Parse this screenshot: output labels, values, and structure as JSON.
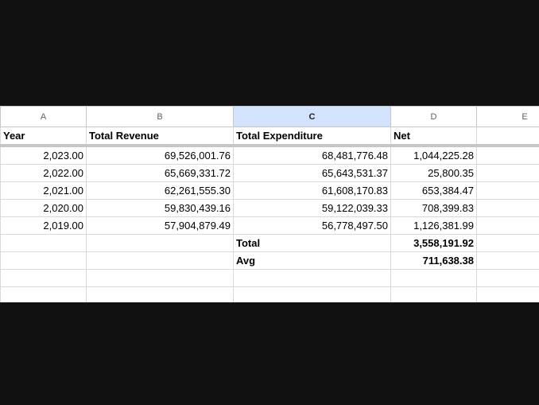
{
  "columns": [
    "A",
    "B",
    "C",
    "D",
    "E"
  ],
  "header": {
    "year": "Year",
    "revenue": "Total Revenue",
    "expenditure": "Total Expenditure",
    "net": "Net"
  },
  "rows": [
    {
      "year": "2,023.00",
      "revenue": "69,526,001.76",
      "expenditure": "68,481,776.48",
      "net": "1,044,225.28"
    },
    {
      "year": "2,022.00",
      "revenue": "65,669,331.72",
      "expenditure": "65,643,531.37",
      "net": "25,800.35"
    },
    {
      "year": "2,021.00",
      "revenue": "62,261,555.30",
      "expenditure": "61,608,170.83",
      "net": "653,384.47"
    },
    {
      "year": "2,020.00",
      "revenue": "59,830,439.16",
      "expenditure": "59,122,039.33",
      "net": "708,399.83"
    },
    {
      "year": "2,019.00",
      "revenue": "57,904,879.49",
      "expenditure": "56,778,497.50",
      "net": "1,126,381.99"
    }
  ],
  "summary": {
    "total_label": "Total",
    "total_value": "3,558,191.92",
    "avg_label": "Avg",
    "avg_value": "711,638.38"
  },
  "colors": {
    "selected_column_header": "#d3e3fd",
    "background": "#111111"
  }
}
